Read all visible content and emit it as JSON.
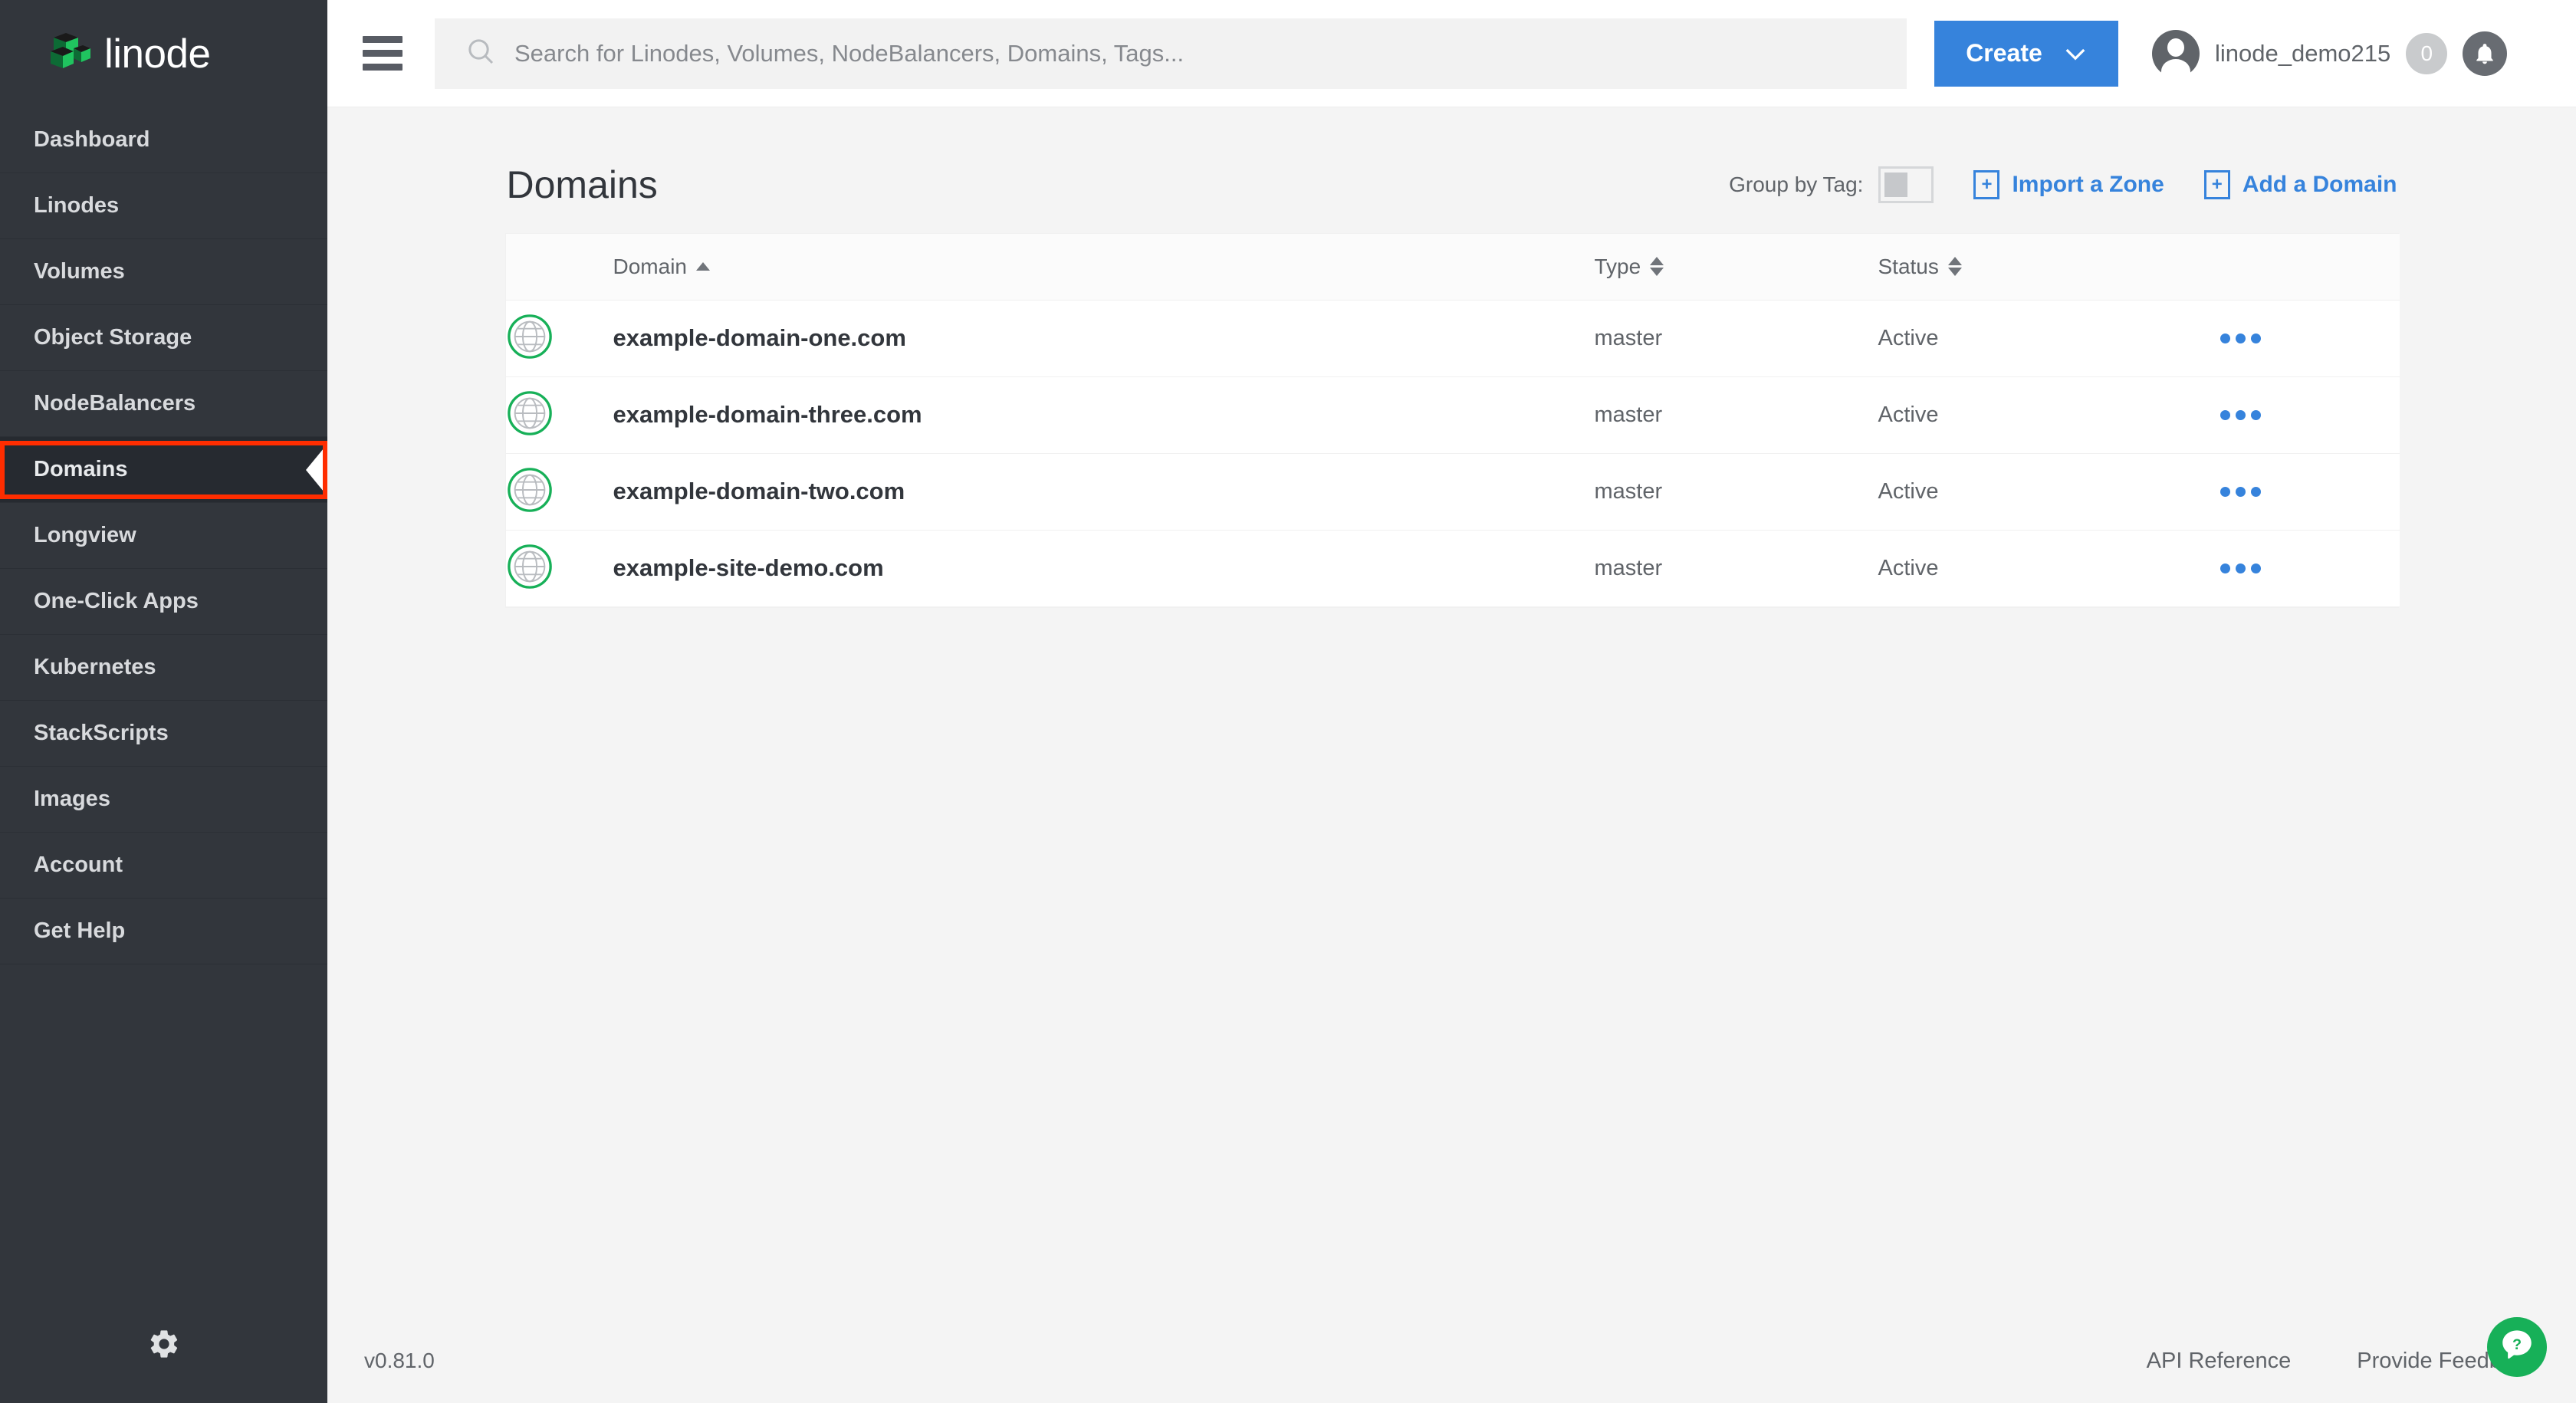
{
  "brand": {
    "name": "linode",
    "logo_icon": "linode-cubes-logo"
  },
  "sidebar": {
    "items": [
      {
        "label": "Dashboard",
        "active": false
      },
      {
        "label": "Linodes",
        "active": false
      },
      {
        "label": "Volumes",
        "active": false
      },
      {
        "label": "Object Storage",
        "active": false
      },
      {
        "label": "NodeBalancers",
        "active": false
      },
      {
        "label": "Domains",
        "active": true
      },
      {
        "label": "Longview",
        "active": false
      },
      {
        "label": "One-Click Apps",
        "active": false
      },
      {
        "label": "Kubernetes",
        "active": false
      },
      {
        "label": "StackScripts",
        "active": false
      },
      {
        "label": "Images",
        "active": false
      },
      {
        "label": "Account",
        "active": false
      },
      {
        "label": "Get Help",
        "active": false
      }
    ],
    "settings_icon": "gear-icon"
  },
  "topbar": {
    "menu_icon": "hamburger-menu-icon",
    "search": {
      "placeholder": "Search for Linodes, Volumes, NodeBalancers, Domains, Tags...",
      "value": "",
      "icon": "search-icon"
    },
    "create_button": {
      "label": "Create",
      "icon": "chevron-down-icon"
    },
    "user": {
      "name": "linode_demo215",
      "avatar_icon": "user-avatar-icon"
    },
    "notifications": {
      "count": "0",
      "bell_icon": "bell-icon"
    }
  },
  "page": {
    "title": "Domains",
    "group_by_tag": {
      "label": "Group by Tag:",
      "enabled": false
    },
    "import_zone": {
      "label": "Import a Zone",
      "icon": "plus-icon"
    },
    "add_domain": {
      "label": "Add a Domain",
      "icon": "plus-icon"
    }
  },
  "table": {
    "columns": [
      {
        "key": "domain",
        "label": "Domain",
        "sort": "asc"
      },
      {
        "key": "type",
        "label": "Type",
        "sort": "none"
      },
      {
        "key": "status",
        "label": "Status",
        "sort": "none"
      }
    ],
    "rows": [
      {
        "icon": "globe-icon",
        "domain": "example-domain-one.com",
        "type": "master",
        "status": "Active",
        "actions_icon": "more-options-icon"
      },
      {
        "icon": "globe-icon",
        "domain": "example-domain-three.com",
        "type": "master",
        "status": "Active",
        "actions_icon": "more-options-icon"
      },
      {
        "icon": "globe-icon",
        "domain": "example-domain-two.com",
        "type": "master",
        "status": "Active",
        "actions_icon": "more-options-icon"
      },
      {
        "icon": "globe-icon",
        "domain": "example-site-demo.com",
        "type": "master",
        "status": "Active",
        "actions_icon": "more-options-icon"
      }
    ]
  },
  "footer": {
    "version": "v0.81.0",
    "api_reference": "API Reference",
    "provide_feedback": "Provide Feedback",
    "help_icon": "help-question-icon"
  },
  "colors": {
    "sidebar_bg": "#32363c",
    "sidebar_active_bg": "#262a30",
    "accent_blue": "#3683dc",
    "green": "#17b058",
    "highlight_red": "#ff2d00",
    "text_dark": "#32363c",
    "text_muted": "#606469"
  }
}
